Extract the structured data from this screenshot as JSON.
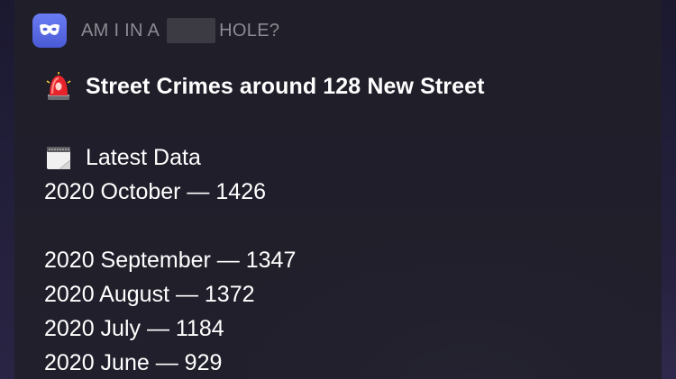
{
  "notification": {
    "app_icon": "mask-icon",
    "app_title_prefix": "AM I IN A",
    "app_title_suffix": "HOLE?",
    "title_icon": "police-light-icon",
    "title": "Street Crimes around 128 New Street",
    "section_icon": "calendar-icon",
    "section_label": "Latest Data",
    "latest_entry": "2020 October — 1426",
    "entries": [
      "2020 September — 1347",
      "2020 August — 1372",
      "2020 July — 1184",
      "2020 June — 929"
    ]
  },
  "colors": {
    "card_bg": "#201f28",
    "app_icon_bg": "#5b6cf0",
    "header_text": "#8c8b92",
    "body_text": "#ffffff",
    "siren_red": "#e8232b"
  }
}
